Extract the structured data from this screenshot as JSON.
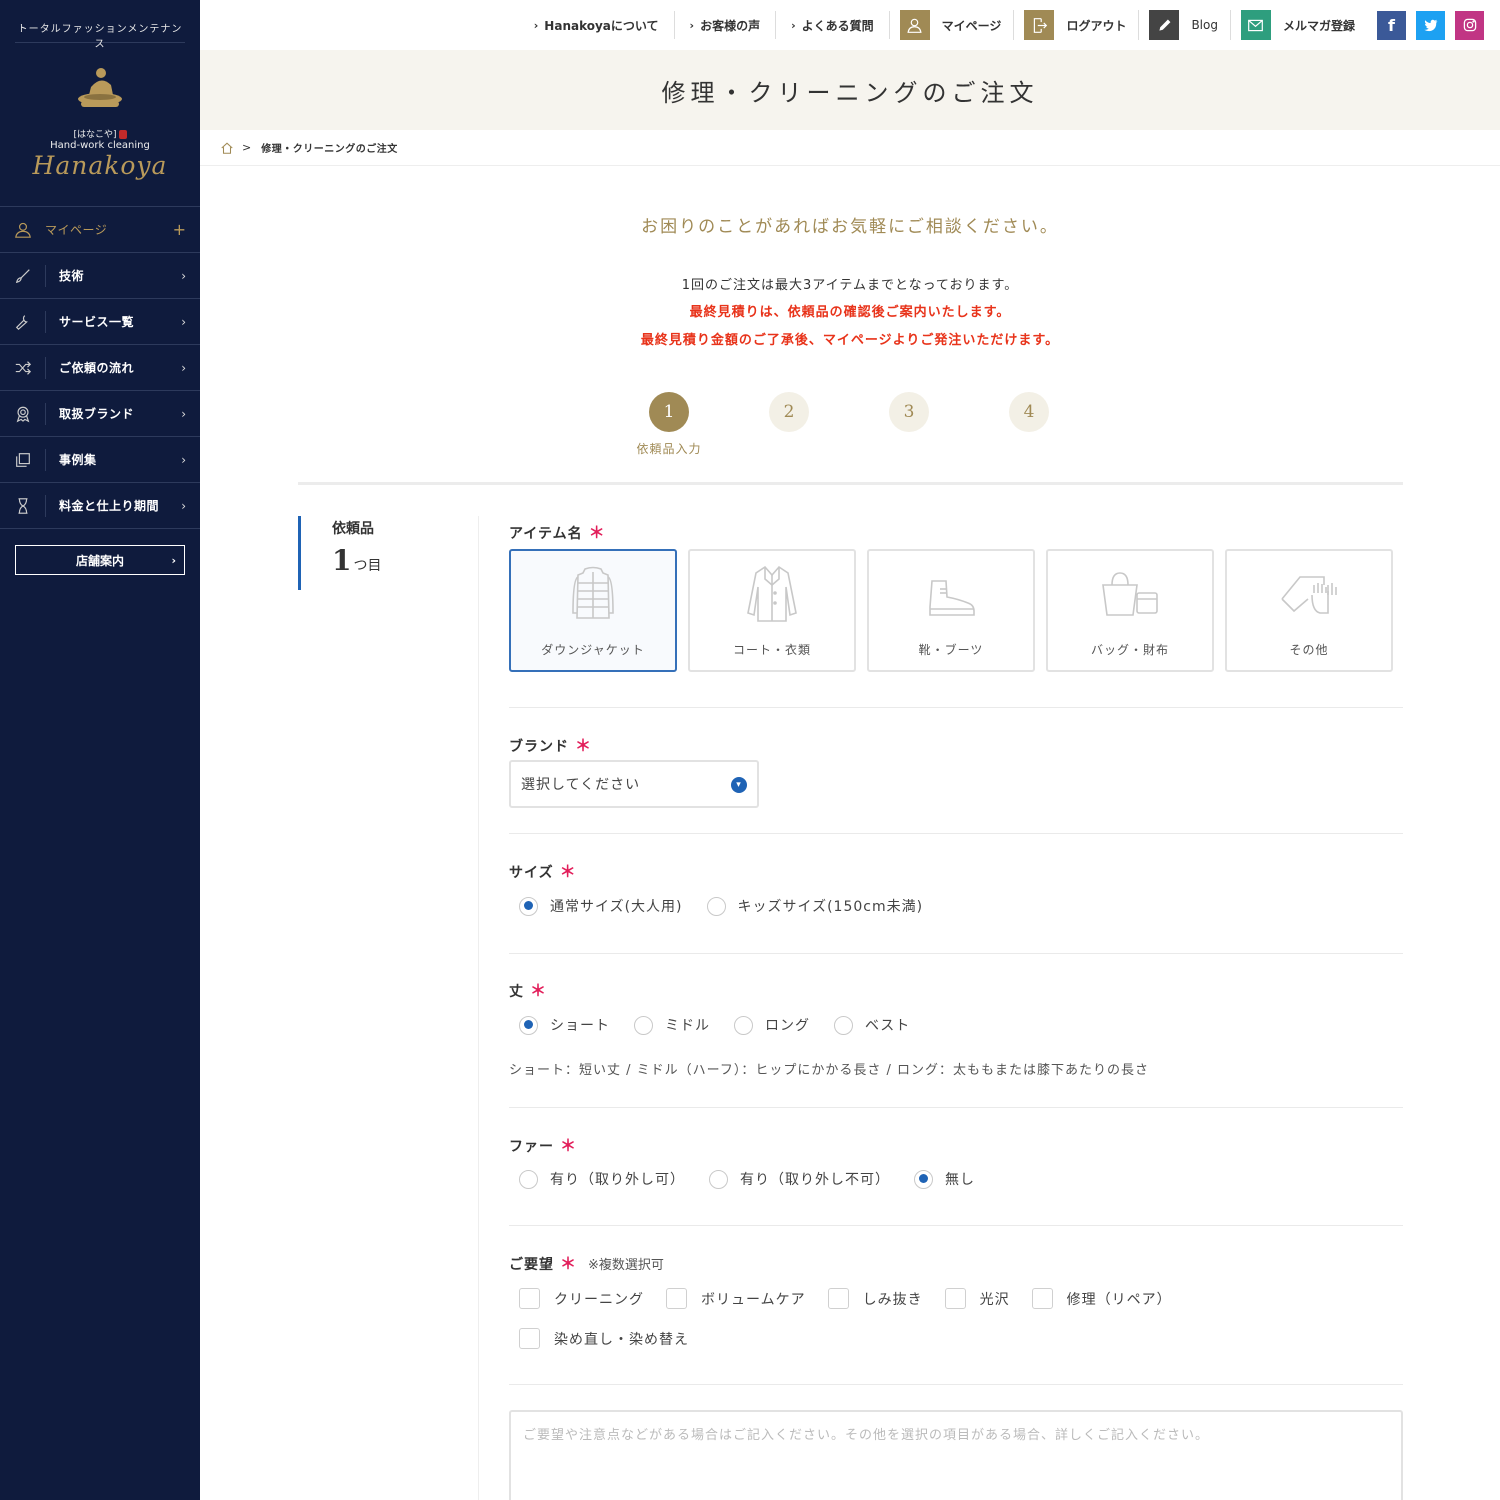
{
  "sidebar": {
    "tagline": "トータルファッションメンテナンス",
    "logo": {
      "kana": "[はなこや]",
      "sub": "Hand-work cleaning",
      "script": "Hanakoya"
    },
    "items": [
      {
        "label": "マイページ",
        "arrow": "+"
      },
      {
        "label": "技術",
        "arrow": "›"
      },
      {
        "label": "サービス一覧",
        "arrow": "›"
      },
      {
        "label": "ご依頼の流れ",
        "arrow": "›"
      },
      {
        "label": "取扱ブランド",
        "arrow": "›"
      },
      {
        "label": "事例集",
        "arrow": "›"
      },
      {
        "label": "料金と仕上り期間",
        "arrow": "›"
      }
    ],
    "store": {
      "label": "店舗案内",
      "arrow": "›"
    }
  },
  "topnav": {
    "links": [
      "Hanakoyaについて",
      "お客様の声",
      "よくある質問"
    ],
    "mypage": "マイページ",
    "logout": "ログアウト",
    "blog": "Blog",
    "newsletter": "メルマガ登録",
    "social": {
      "facebook": "f"
    }
  },
  "page": {
    "title": "修理・クリーニングのご注文",
    "breadcrumb": {
      "sep": ">",
      "current": "修理・クリーニングのご注文"
    },
    "lead": "お困りのことがあればお気軽にご相談ください。",
    "note1": "1回のご注文は最大3アイテムまでとなっております。",
    "note2": "最終見積りは、依頼品の確認後ご案内いたします。",
    "note3": "最終見積り金額のご了承後、マイページよりご発注いただけます。"
  },
  "steps": {
    "items": [
      "1",
      "2",
      "3",
      "4"
    ],
    "active_label": "依頼品入力"
  },
  "item": {
    "label": "依頼品",
    "number": "1",
    "suffix": "つ目"
  },
  "form": {
    "item_name": {
      "label": "アイテム名",
      "required": "＊",
      "options": [
        "ダウンジャケット",
        "コート・衣類",
        "靴・ブーツ",
        "バッグ・財布",
        "その他"
      ],
      "selected": "ダウンジャケット"
    },
    "brand": {
      "label": "ブランド",
      "required": "＊",
      "placeholder": "選択してください"
    },
    "size": {
      "label": "サイズ",
      "required": "＊",
      "options": [
        "通常サイズ(大人用)",
        "キッズサイズ(150cm未満)"
      ],
      "selected": "通常サイズ(大人用)"
    },
    "length": {
      "label": "丈",
      "required": "＊",
      "options": [
        "ショート",
        "ミドル",
        "ロング",
        "ベスト"
      ],
      "selected": "ショート",
      "hint": "ショート：短い丈 / ミドル（ハーフ）：ヒップにかかる長さ / ロング：太ももまたは膝下あたりの長さ"
    },
    "fur": {
      "label": "ファー",
      "required": "＊",
      "options": [
        "有り（取り外し可）",
        "有り（取り外し不可）",
        "無し"
      ],
      "selected": "無し"
    },
    "requests": {
      "label": "ご要望",
      "required": "＊",
      "note": "※複数選択可",
      "options": [
        "クリーニング",
        "ボリュームケア",
        "しみ抜き",
        "光沢",
        "修理（リペア）",
        "染め直し・染め替え"
      ]
    },
    "comment": {
      "placeholder": "ご要望や注意点などがある場合はご記入ください。その他を選択の項目がある場合、詳しくご記入ください。"
    }
  },
  "colors": {
    "sidebar_bg": "#0f1b3d",
    "gold": "#a08a55",
    "accent_blue": "#1f63b5",
    "warning_red": "#e8331a",
    "required_pink": "#e21e5a",
    "facebook": "#3b5998",
    "twitter": "#1da1f2",
    "instagram": "#c13584"
  }
}
